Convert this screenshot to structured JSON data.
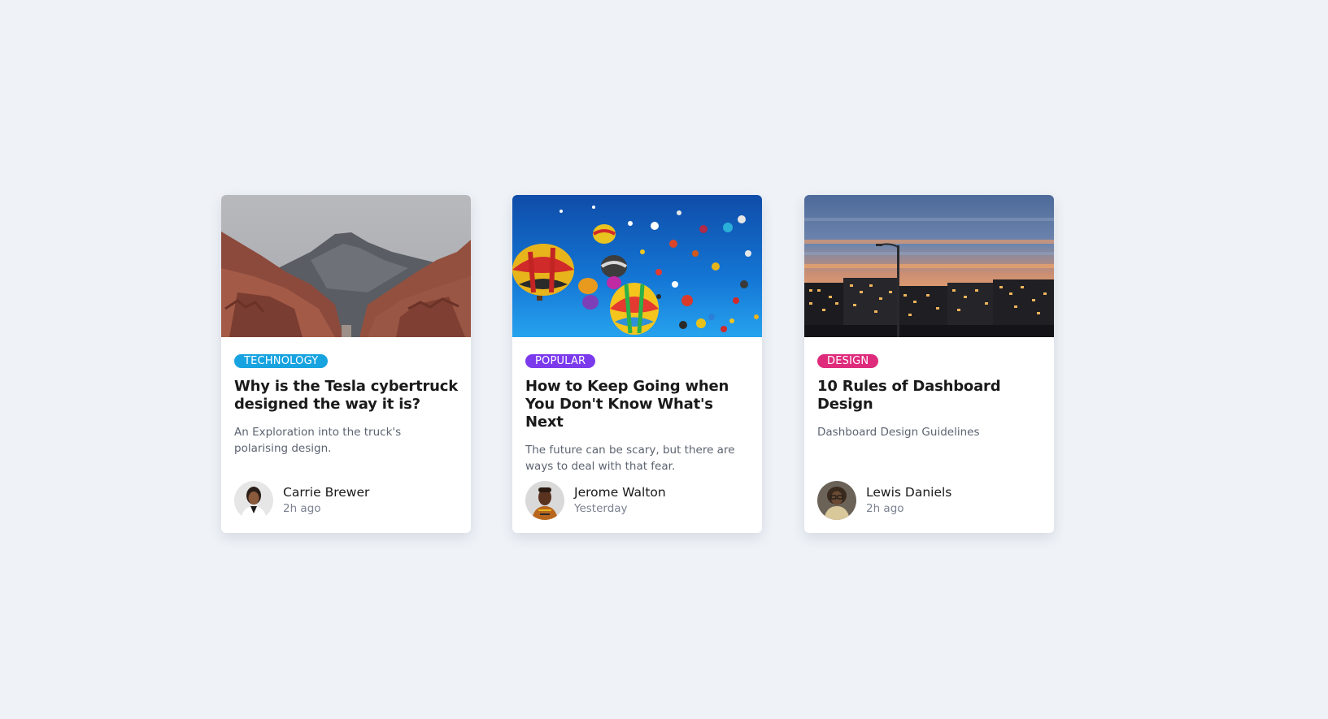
{
  "cards": [
    {
      "tag": "TECHNOLOGY",
      "tag_color": "#17a3e0",
      "title": "Why is the Tesla cybertruck designed the way it is?",
      "excerpt": "An Exploration into the truck's polarising design.",
      "author": "Carrie Brewer",
      "time": "2h ago",
      "image": "canyon-mountains-photo"
    },
    {
      "tag": "POPULAR",
      "tag_color": "#7c3aed",
      "title": "How to Keep Going when You Don't Know What's Next",
      "excerpt": "The future can be scary, but there are ways to deal with that fear.",
      "author": "Jerome Walton",
      "time": "Yesterday",
      "image": "hot-air-balloons-photo"
    },
    {
      "tag": "DESIGN",
      "tag_color": "#de2b7c",
      "title": "10 Rules of Dashboard Design",
      "excerpt": "Dashboard Design Guidelines",
      "author": "Lewis Daniels",
      "time": "2h ago",
      "image": "city-sunset-photo"
    }
  ]
}
